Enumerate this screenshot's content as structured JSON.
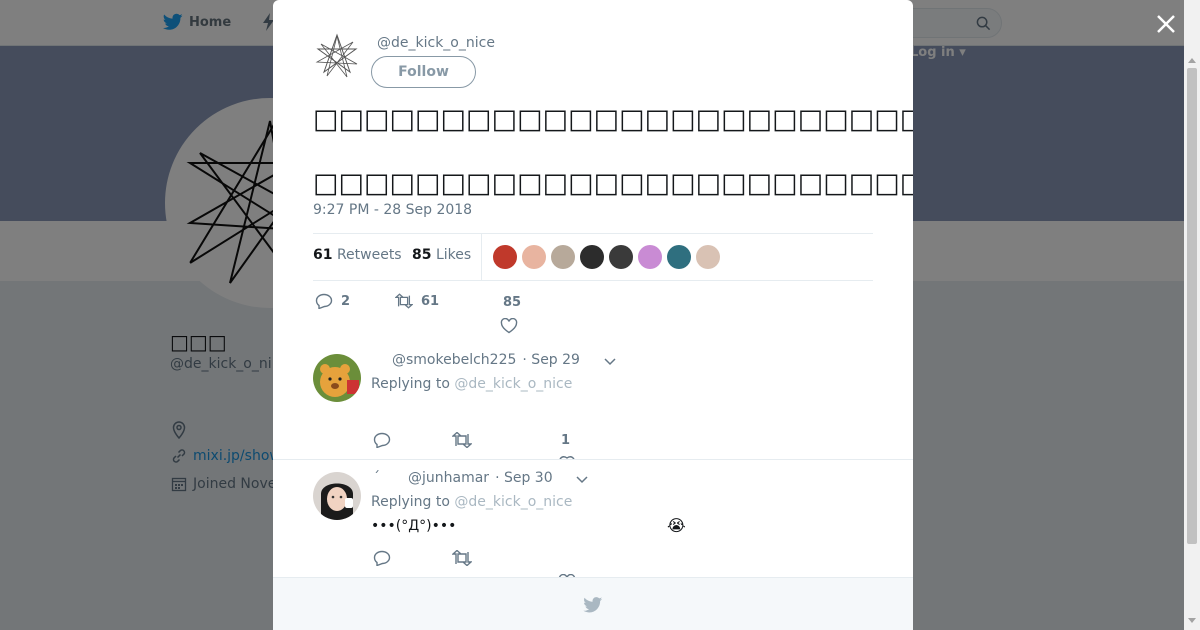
{
  "background": {
    "nav_home_label": "Home",
    "login_label": "Log in",
    "profile_name": "□□□",
    "profile_handle": "@de_kick_o_ni",
    "profile_link": "mixi.jp/show",
    "joined_text": "Joined Nove"
  },
  "tweet": {
    "handle": "@de_kick_o_nice",
    "follow_label": "Follow",
    "text": "□□□□□□□□□□□□□□□□□□□□□□□□□□□□□□□□□□□□□□□□□□□□□□□□□□□□□□□□□□□□□□□□",
    "timestamp": "9:27 PM - 28 Sep 2018",
    "retweets_count": "61",
    "retweets_label": "Retweets",
    "likes_count": "85",
    "likes_label": "Likes",
    "reply_count": "2",
    "retweet_count_action": "61",
    "like_count_action": "85",
    "liker_colors": [
      "#c0392b",
      "#e8b4a0",
      "#b7a99a",
      "#2c2c2c",
      "#3a3a3a",
      "#c98bd4",
      "#2f6f7f",
      "#d9c2b4"
    ]
  },
  "replies": [
    {
      "handle": "@smokebelch225",
      "date": "· Sep 29",
      "replying_prefix": "Replying to",
      "replying_to": "@de_kick_o_nice",
      "body": "",
      "like_count": "1"
    },
    {
      "name_glyph": "´",
      "handle": "@junhamar",
      "date": "· Sep 30",
      "replying_prefix": "Replying to",
      "replying_to": "@de_kick_o_nice",
      "body": "•••(°Д°)•••",
      "emoji": "😭",
      "like_count": ""
    }
  ],
  "colors": {
    "accent": "#1da1f2",
    "muted": "#657786",
    "overlay": "rgba(0,0,0,0.5)"
  }
}
